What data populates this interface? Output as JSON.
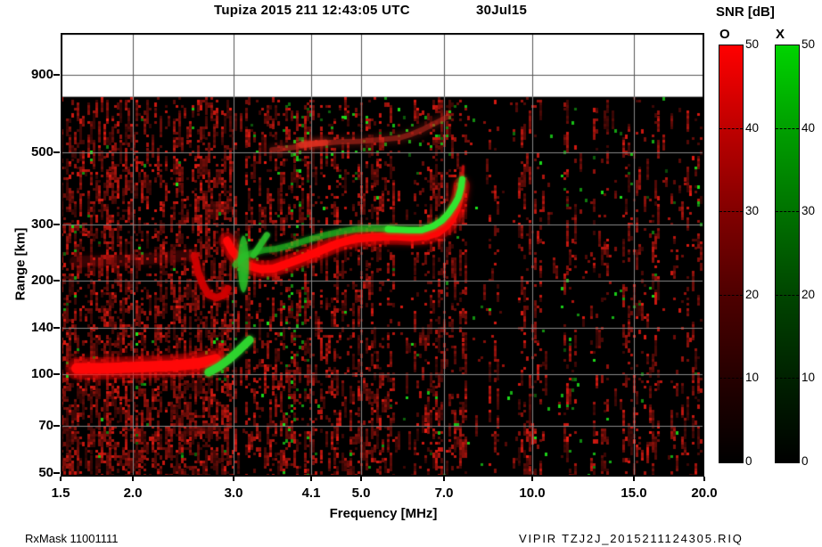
{
  "header": {
    "title": "Tupiza 2015 211 12:43:05 UTC",
    "date": "30Jul15"
  },
  "footer": {
    "left": "RxMask 11001111",
    "right": "VIPIR  TZJ2J_2015211124305.RIQ"
  },
  "axes": {
    "x": {
      "label": "Frequency [MHz]",
      "scale": "log",
      "ticks": [
        {
          "v": "1.5",
          "px": 68
        },
        {
          "v": "2.0",
          "px": 149
        },
        {
          "v": "3.0",
          "px": 262
        },
        {
          "v": "4.1",
          "px": 349
        },
        {
          "v": "5.0",
          "px": 405
        },
        {
          "v": "7.0",
          "px": 498
        },
        {
          "v": "10.0",
          "px": 597
        },
        {
          "v": "15.0",
          "px": 711
        },
        {
          "v": "20.0",
          "px": 790
        }
      ]
    },
    "y": {
      "label": "Range [km]",
      "scale": "log",
      "ticks": [
        {
          "v": "900",
          "py": 84
        },
        {
          "v": "500",
          "py": 171
        },
        {
          "v": "300",
          "py": 252
        },
        {
          "v": "200",
          "py": 315
        },
        {
          "v": "140",
          "py": 368
        },
        {
          "v": "100",
          "py": 420
        },
        {
          "v": "70",
          "py": 478
        },
        {
          "v": "50",
          "py": 531
        }
      ]
    }
  },
  "colorbars": {
    "title": "SNR [dB]",
    "ticks": [
      "50",
      "40",
      "30",
      "20",
      "10",
      "0"
    ],
    "bars": [
      {
        "label": "O",
        "stops": [
          [
            0,
            "#ff0000"
          ],
          [
            0.18,
            "#c40000"
          ],
          [
            0.4,
            "#820000"
          ],
          [
            0.6,
            "#4e0000"
          ],
          [
            0.8,
            "#250000"
          ],
          [
            1,
            "#000000"
          ]
        ]
      },
      {
        "label": "X",
        "stops": [
          [
            0,
            "#00d400"
          ],
          [
            0.18,
            "#00a400"
          ],
          [
            0.4,
            "#007200"
          ],
          [
            0.6,
            "#004500"
          ],
          [
            0.8,
            "#002100"
          ],
          [
            1,
            "#000000"
          ]
        ]
      }
    ]
  },
  "chart_data": {
    "type": "heatmap",
    "title": "Tupiza 2015 211 12:43:05 UTC 30Jul15 — VIPIR ionogram, O-mode (red) and X-mode (green) SNR [dB] 0–50",
    "xlabel": "Frequency [MHz]",
    "ylabel": "Range [km]",
    "xlim_mhz": [
      1.5,
      20.0
    ],
    "ylim_km": [
      50,
      1000
    ],
    "data_top_km": 745,
    "features": {
      "E_layer": {
        "height_km": 106,
        "f_start_mhz": 1.6,
        "foE_mhz": 2.8,
        "fxE_mhz": 3.2
      },
      "F_layer": {
        "min_virtual_height_km": 216,
        "foF2_mhz": 7.5,
        "fxF2_mhz": 7.6
      },
      "second_hop_km": [
        509,
        647
      ]
    },
    "traces": [
      {
        "name": "E-layer O-mode",
        "color": "#ff0808",
        "width": 12,
        "alpha": 0.95,
        "blur": 7,
        "halo": true,
        "points": [
          [
            1.6,
            106
          ],
          [
            1.8,
            106
          ],
          [
            2.05,
            107
          ],
          [
            2.35,
            108
          ],
          [
            2.62,
            110
          ],
          [
            2.8,
            113
          ]
        ]
      },
      {
        "name": "E-layer X-mode",
        "color": "#2ed52e",
        "width": 9,
        "alpha": 0.95,
        "blur": 4,
        "points": [
          [
            2.72,
            103
          ],
          [
            2.83,
            107
          ],
          [
            2.95,
            113
          ],
          [
            3.08,
            121
          ],
          [
            3.21,
            130
          ]
        ]
      },
      {
        "name": "E-F cusp",
        "color": "#d40000",
        "width": 8,
        "alpha": 0.85,
        "blur": 5,
        "points": [
          [
            2.57,
            238
          ],
          [
            2.61,
            211
          ],
          [
            2.66,
            193
          ],
          [
            2.72,
            180
          ],
          [
            2.81,
            176
          ],
          [
            2.9,
            180
          ],
          [
            2.94,
            188
          ]
        ]
      },
      {
        "name": "diffuse band 230km",
        "color": "#cc1111",
        "width": 13,
        "alpha": 0.16,
        "blur": 9,
        "points": [
          [
            1.59,
            228
          ],
          [
            1.9,
            230
          ],
          [
            2.25,
            234
          ],
          [
            2.54,
            240
          ]
        ]
      },
      {
        "name": "F-layer O-mode",
        "color": "#ff0606",
        "width": 9,
        "alpha": 0.97,
        "blur": 7,
        "halo": true,
        "points": [
          [
            2.93,
            265
          ],
          [
            2.99,
            247
          ],
          [
            3.08,
            232
          ],
          [
            3.19,
            222
          ],
          [
            3.36,
            216
          ],
          [
            3.53,
            217
          ],
          [
            3.74,
            225
          ],
          [
            3.99,
            235
          ],
          [
            4.27,
            247
          ],
          [
            4.58,
            260
          ],
          [
            4.91,
            269
          ],
          [
            5.27,
            272
          ],
          [
            5.7,
            274
          ],
          [
            6.16,
            272
          ],
          [
            6.52,
            274
          ],
          [
            6.84,
            281
          ],
          [
            7.07,
            294
          ],
          [
            7.25,
            311
          ],
          [
            7.38,
            334
          ],
          [
            7.48,
            365
          ],
          [
            7.53,
            394
          ]
        ]
      },
      {
        "name": "F-layer O cusp tail",
        "color": "#e01010",
        "width": 3,
        "alpha": 0.7,
        "blur": 3,
        "points": [
          [
            7.5,
            370
          ],
          [
            7.56,
            420
          ],
          [
            7.58,
            452
          ]
        ]
      },
      {
        "name": "F-layer X-mode",
        "color": "#25c525",
        "width": 7,
        "alpha": 0.55,
        "blur": 4,
        "points": [
          [
            3.03,
            223
          ],
          [
            3.13,
            237
          ],
          [
            3.25,
            243
          ],
          [
            3.4,
            248
          ],
          [
            3.57,
            250
          ],
          [
            3.8,
            257
          ],
          [
            4.06,
            267
          ],
          [
            4.35,
            276
          ],
          [
            4.63,
            283
          ],
          [
            4.93,
            288
          ],
          [
            5.3,
            290
          ],
          [
            5.7,
            288
          ]
        ]
      },
      {
        "name": "F-layer X-mode bright",
        "color": "#30e830",
        "width": 7,
        "alpha": 0.95,
        "blur": 4,
        "points": [
          [
            5.6,
            288
          ],
          [
            6.08,
            286
          ],
          [
            6.4,
            286
          ],
          [
            6.71,
            294
          ],
          [
            6.95,
            306
          ],
          [
            7.14,
            322
          ],
          [
            7.3,
            341
          ],
          [
            7.43,
            361
          ],
          [
            7.51,
            386
          ],
          [
            7.55,
            412
          ]
        ]
      },
      {
        "name": "X-mode streak",
        "color": "#2abf2a",
        "width": 7,
        "alpha": 0.8,
        "blur": 3,
        "points": [
          [
            3.26,
            239
          ],
          [
            3.44,
            276
          ]
        ]
      },
      {
        "name": "second-hop echo",
        "color": "#c82a1e",
        "width": 6,
        "alpha": 0.5,
        "blur": 8,
        "points": [
          [
            3.51,
            509
          ],
          [
            3.82,
            518
          ],
          [
            4.18,
            532
          ],
          [
            4.6,
            539
          ],
          [
            5.04,
            542
          ],
          [
            5.52,
            549
          ],
          [
            5.89,
            556
          ],
          [
            6.16,
            570
          ],
          [
            6.44,
            589
          ],
          [
            6.7,
            611
          ],
          [
            6.95,
            631
          ],
          [
            7.14,
            647
          ]
        ]
      },
      {
        "name": "second-hop bright",
        "color": "#e03020",
        "width": 7,
        "alpha": 0.75,
        "blur": 7,
        "points": [
          [
            3.95,
            528
          ],
          [
            4.35,
            536
          ]
        ]
      }
    ],
    "blobs": [
      {
        "f": 3.13,
        "r": 224,
        "rx": 6,
        "ry": 32,
        "color": "#2abf2a",
        "alpha": 0.75,
        "blur": 4
      }
    ],
    "noise": {
      "cell": 3,
      "red_base": 0.16,
      "green_base": 0.0045,
      "dark_bands_mhz": [
        [
          3.05,
          3.16
        ],
        [
          5.77,
          6.2
        ],
        [
          7.7,
          8.35
        ],
        [
          8.75,
          9.35
        ],
        [
          10.6,
          11.3
        ],
        [
          12.0,
          12.6
        ],
        [
          13.6,
          14.4
        ],
        [
          16.7,
          17.5
        ]
      ],
      "green_hotspots": [
        {
          "f": [
            3.66,
            4.06
          ],
          "r": [
            50,
            760
          ],
          "k": 12
        },
        {
          "f": [
            3.8,
            7.3
          ],
          "r": [
            495,
            680
          ],
          "k": 9
        },
        {
          "f": [
            2.02,
            2.15
          ],
          "r": [
            50,
            145
          ],
          "k": 7
        },
        {
          "f": [
            1.5,
            1.62
          ],
          "r": [
            88,
            310
          ],
          "k": 5
        },
        {
          "f": [
            11.2,
            11.95
          ],
          "r": [
            50,
            760
          ],
          "k": 6
        },
        {
          "f": [
            3.0,
            4.1
          ],
          "r": [
            150,
            300
          ],
          "k": 4
        },
        {
          "f": [
            2.9,
            3.45
          ],
          "r": [
            145,
            190
          ],
          "k": 5
        },
        {
          "f": [
            19.2,
            20.0
          ],
          "r": [
            285,
            410
          ],
          "k": 7
        },
        {
          "f": [
            12.1,
            12.9
          ],
          "r": [
            52,
            66
          ],
          "k": 6
        },
        {
          "f": [
            7.35,
            7.75
          ],
          "r": [
            380,
            480
          ],
          "k": 8
        },
        {
          "f": [
            2.6,
            3.0
          ],
          "r": [
            95,
            135
          ],
          "k": 5
        }
      ]
    }
  }
}
